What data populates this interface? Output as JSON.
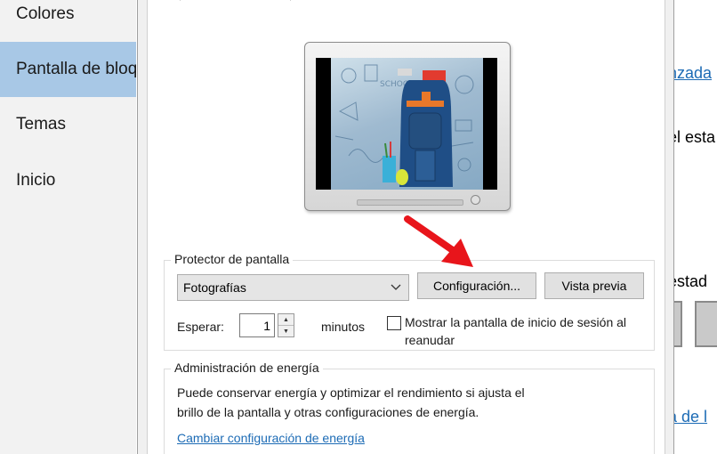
{
  "sidebar": {
    "items": [
      {
        "label": "Colores",
        "active": false
      },
      {
        "label": "Pantalla de bloqueo",
        "active": true
      },
      {
        "label": "Temas",
        "active": false
      },
      {
        "label": "Inicio",
        "active": false
      }
    ]
  },
  "background_right": {
    "line1": "nzada",
    "line2": "el esta",
    "line3": "estad",
    "line4": "a de l"
  },
  "dialog": {
    "screensaver": {
      "legend": "Protector de pantalla",
      "selected": "Fotografías",
      "settings_button": "Configuración...",
      "preview_button": "Vista previa",
      "wait_label": "Esperar:",
      "wait_value": "1",
      "minutes_label": "minutos",
      "resume_checkbox_label_line1": "Mostrar la pantalla de inicio de sesión al",
      "resume_checkbox_label_line2": "reanudar",
      "resume_checked": false
    },
    "power": {
      "legend": "Administración de energía",
      "description_line1": "Puede conservar energía y optimizar el rendimiento si ajusta el",
      "description_line2": "brillo de la pantalla y otras configuraciones de energía.",
      "link": "Cambiar configuración de energía"
    }
  },
  "colors": {
    "sidebar_active": "#a8c8e6",
    "link": "#1c6bb5",
    "annotation_arrow": "#e8151b"
  }
}
